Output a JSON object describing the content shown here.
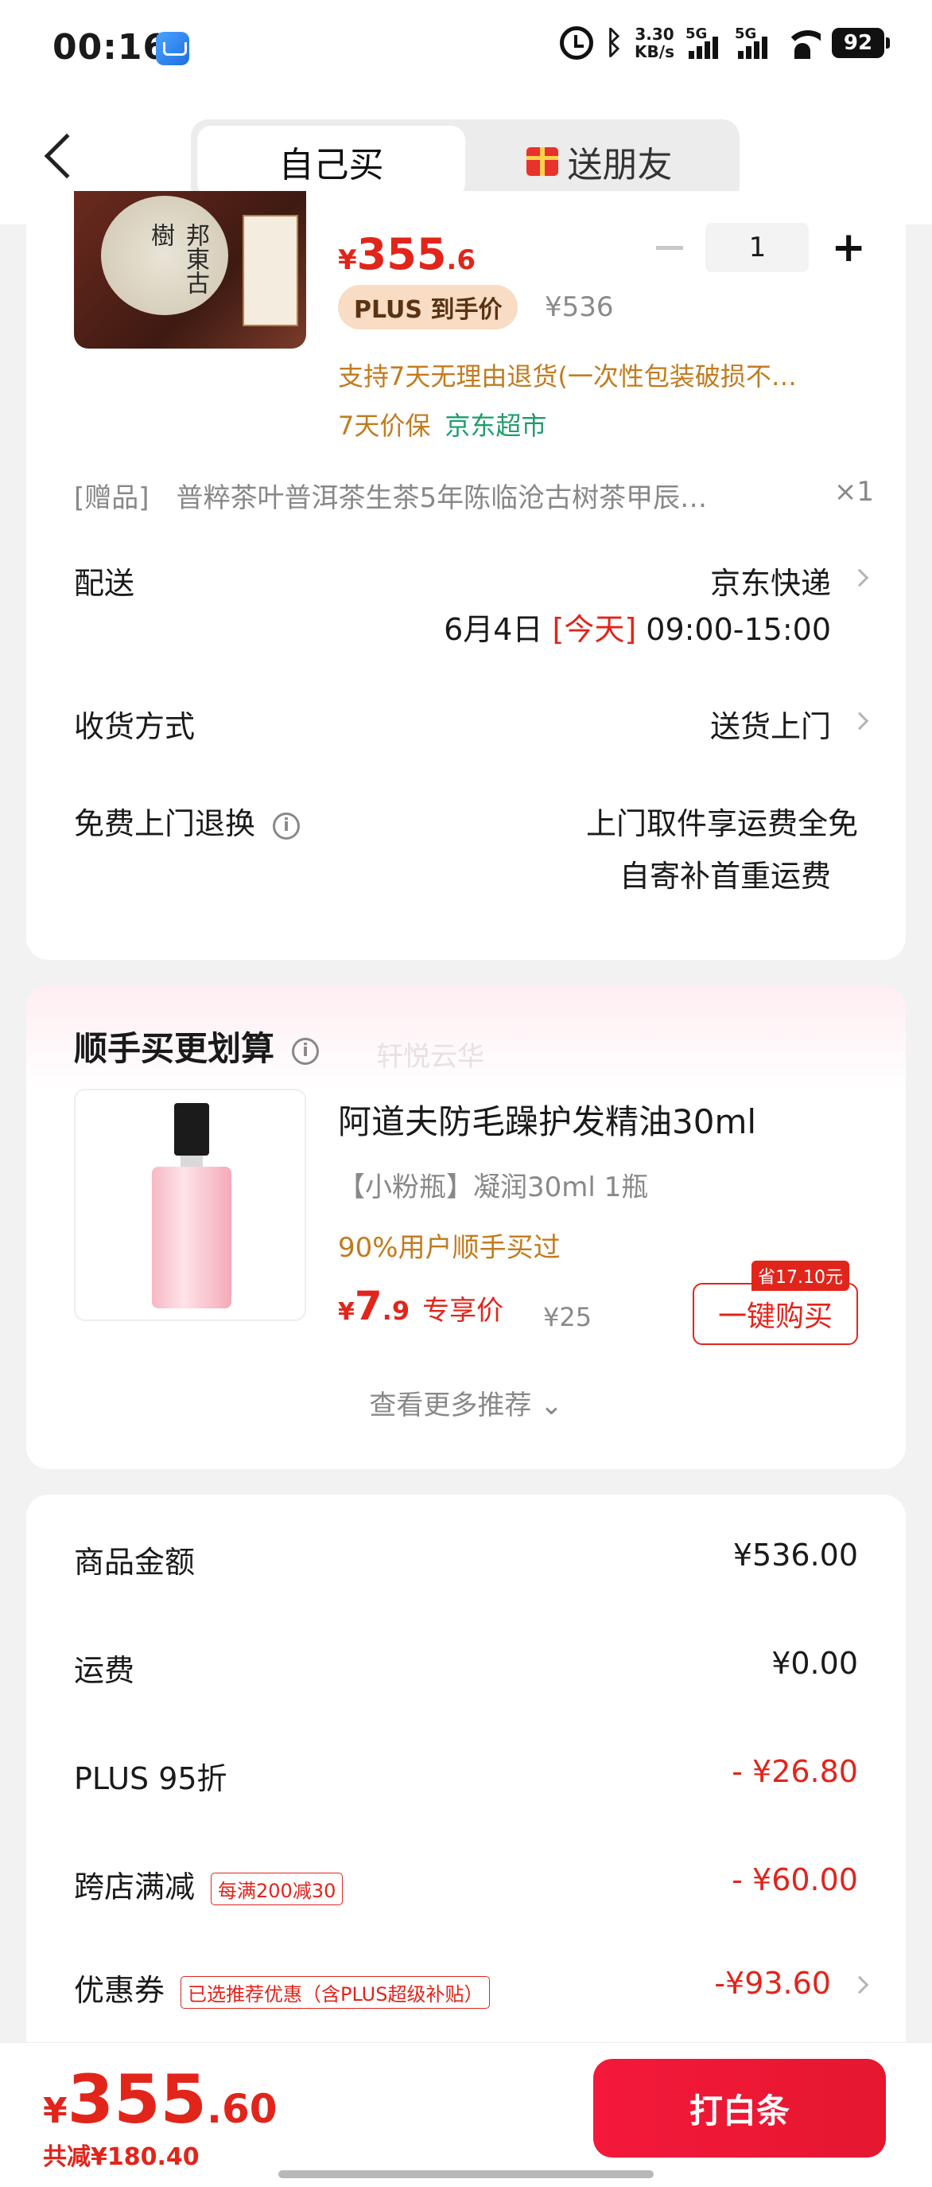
{
  "status_bar": {
    "time": "00:16",
    "speed_top": "3.30",
    "speed_unit": "KB/s",
    "sig1": "5G",
    "sig2": "5G",
    "battery": "92"
  },
  "header": {
    "tab_self": "自己买",
    "tab_friend": "送朋友"
  },
  "product": {
    "price_yen": "¥",
    "price_int": "355",
    "price_dec": ".6",
    "quantity": "1",
    "plus_label": "PLUS 到手价",
    "orig_price": "¥536",
    "support_text": "支持7天无理由退货(一次性包装破损不…",
    "protect": "7天价保",
    "store": "京东超市",
    "thumb_text": "邦東古樹",
    "gift_text": "[赠品]　普粹茶叶普洱茶生茶5年陈临沧古树茶甲辰…",
    "gift_qty": "×1"
  },
  "delivery": {
    "label": "配送",
    "carrier": "京东快递",
    "date": "6月4日",
    "today": "[今天]",
    "window": "09:00-15:00",
    "receive_label": "收货方式",
    "receive_value": "送货上门",
    "return_label": "免费上门退换",
    "return_line1": "上门取件享运费全免",
    "return_line2": "自寄补首重运费"
  },
  "recommend": {
    "title": "顺手买更划算",
    "watermark": "轩悦云华",
    "name": "阿道夫防毛躁护发精油30ml",
    "spec": "【小粉瓶】凝润30ml 1瓶",
    "note": "90%用户顺手买过",
    "price_yen": "¥",
    "price_int": "7",
    "price_dec": ".9",
    "price_tag": "专享价",
    "orig": "¥25",
    "save_tag": "省17.10元",
    "buy_label": "一键购买",
    "more": "查看更多推荐 ⌄"
  },
  "summary": {
    "goods_label": "商品金额",
    "goods_value": "¥536.00",
    "ship_label": "运费",
    "ship_value": "¥0.00",
    "plus_label": "PLUS 95折",
    "plus_value": "- ¥26.80",
    "cross_label": "跨店满减",
    "cross_tag": "每满200减30",
    "cross_value": "- ¥60.00",
    "coupon_label": "优惠券",
    "coupon_tag": "已选推荐优惠（含PLUS超级补贴）",
    "coupon_value": "-¥93.60"
  },
  "footer": {
    "total_yen": "¥",
    "total_int": "355",
    "total_dec": ".60",
    "saved": "共减¥180.40",
    "pay_label": "打白条"
  },
  "colors": {
    "accent_red": "#e1251b",
    "pay_button": "#f4183a",
    "promo_orange": "#c27b1e",
    "store_green": "#1e9e6a"
  }
}
